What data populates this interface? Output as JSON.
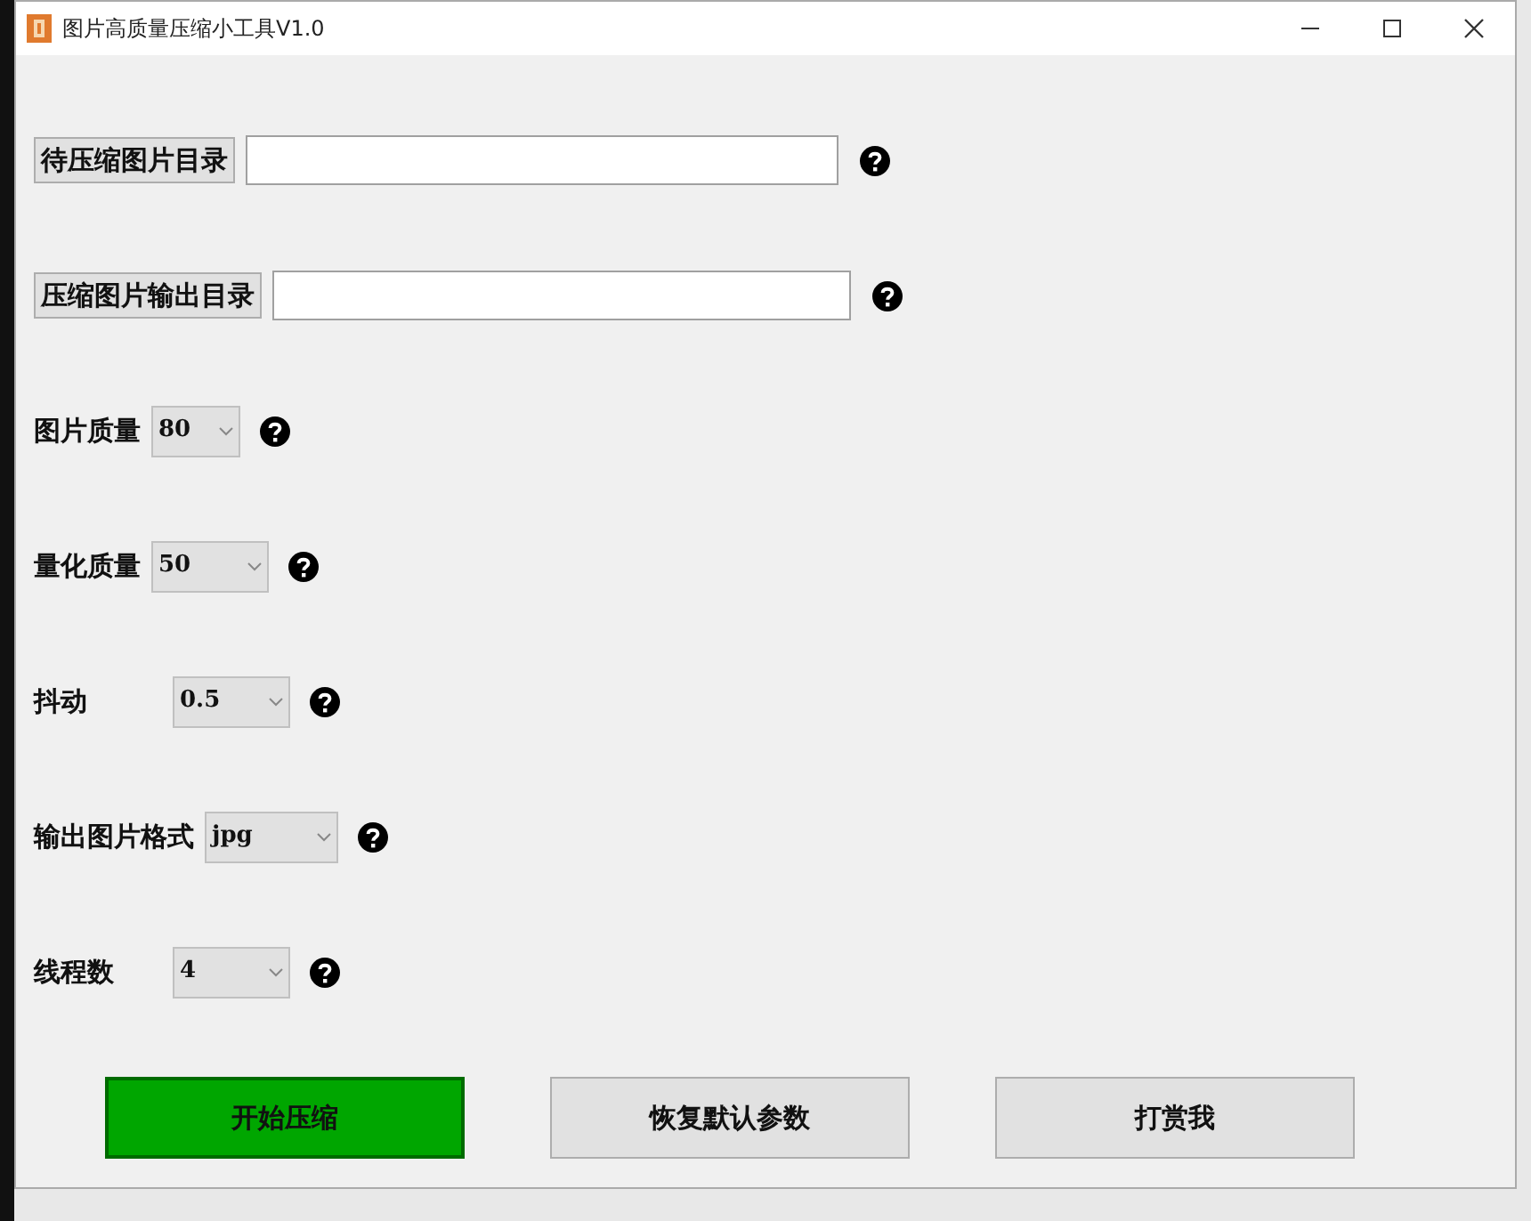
{
  "window": {
    "title": "图片高质量压缩小工具V1.0"
  },
  "rows": [
    {
      "kind": "directory",
      "label": "待压缩图片目录"
    },
    {
      "kind": "directory",
      "label": "压缩图片输出目录"
    },
    {
      "kind": "select",
      "label": "图片质量",
      "value": "80"
    },
    {
      "kind": "select",
      "label": "量化质量",
      "value": "50"
    },
    {
      "kind": "select",
      "label": "抖动",
      "value": "0.5"
    },
    {
      "kind": "select",
      "label": "输出图片格式",
      "value": "jpg"
    },
    {
      "kind": "select",
      "label": "线程数",
      "value": "4"
    }
  ],
  "buttons": [
    {
      "kind": "primary",
      "label": "开始压缩"
    },
    {
      "kind": "default",
      "label": "恢复默认参数"
    },
    {
      "kind": "default",
      "label": "打赏我"
    }
  ]
}
